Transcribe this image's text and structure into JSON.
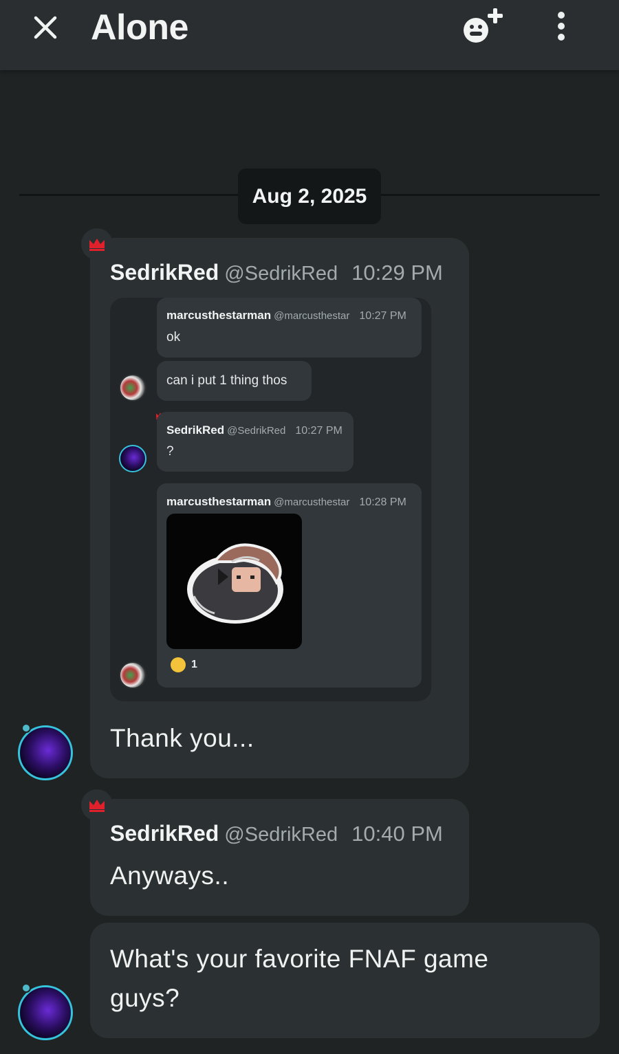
{
  "header": {
    "title": "Alone",
    "close_icon": "close-icon",
    "add_member_icon": "add-member-icon",
    "menu_icon": "more-vertical-icon"
  },
  "date_divider": "Aug 2, 2025",
  "messages": [
    {
      "username": "SedrikRed",
      "handle": "@SedrikRed",
      "time": "10:29 PM",
      "text": "Thank you...",
      "quoted": [
        {
          "username": "marcusthestarman",
          "handle": "@marcusthestar",
          "time": "10:27 PM",
          "text": "ok"
        },
        {
          "text": "can i put 1 thing thos"
        },
        {
          "username": "SedrikRed",
          "handle": "@SedrikRed",
          "time": "10:27 PM",
          "text": "?"
        },
        {
          "username": "marcusthestarman",
          "handle": "@marcusthestar",
          "time": "10:28 PM",
          "reaction_count": "1"
        }
      ]
    },
    {
      "username": "SedrikRed",
      "handle": "@SedrikRed",
      "time": "10:40 PM",
      "text": "Anyways.."
    },
    {
      "text_line1": "What's your favorite FNAF game",
      "text_line2": "guys?"
    }
  ],
  "colors": {
    "background": "#1f2324",
    "bubble": "#2b3032",
    "crown": "#e0202a",
    "avatar_ring": "#36c3dc"
  }
}
